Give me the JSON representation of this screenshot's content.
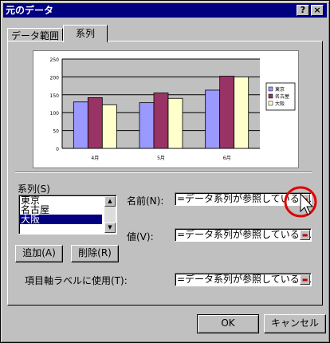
{
  "window": {
    "title": "元のデータ",
    "help_label": "?",
    "close_label": "×"
  },
  "tabs": [
    {
      "label": "データ範囲"
    },
    {
      "label": "系列"
    }
  ],
  "chart_data": {
    "type": "bar",
    "categories": [
      "4月",
      "5月",
      "6月"
    ],
    "series": [
      {
        "name": "東京",
        "values": [
          130,
          128,
          163
        ],
        "color": "#9999ff"
      },
      {
        "name": "名古屋",
        "values": [
          142,
          155,
          202
        ],
        "color": "#993366"
      },
      {
        "name": "大阪",
        "values": [
          122,
          140,
          200
        ],
        "color": "#ffffcc"
      }
    ],
    "yticks": [
      "250",
      "200",
      "150",
      "100",
      "50",
      "0"
    ],
    "ylim": [
      0,
      250
    ],
    "grid": true,
    "legend": "right"
  },
  "series_section": {
    "label": "系列(S)",
    "items": [
      "東京",
      "名古屋",
      "大阪"
    ],
    "selected_index": 2,
    "add_label": "追加(A)",
    "delete_label": "削除(R)"
  },
  "fields": {
    "name_label": "名前(N):",
    "name_value": "=データ系列が参照しているセル",
    "values_label": "値(V):",
    "values_value": "=データ系列が参照しているセル",
    "xaxis_label": "項目軸ラベルに使用(T):",
    "xaxis_value": "=データ系列が参照しているセル"
  },
  "buttons": {
    "ok_label": "OK",
    "cancel_label": "キャンセル"
  }
}
